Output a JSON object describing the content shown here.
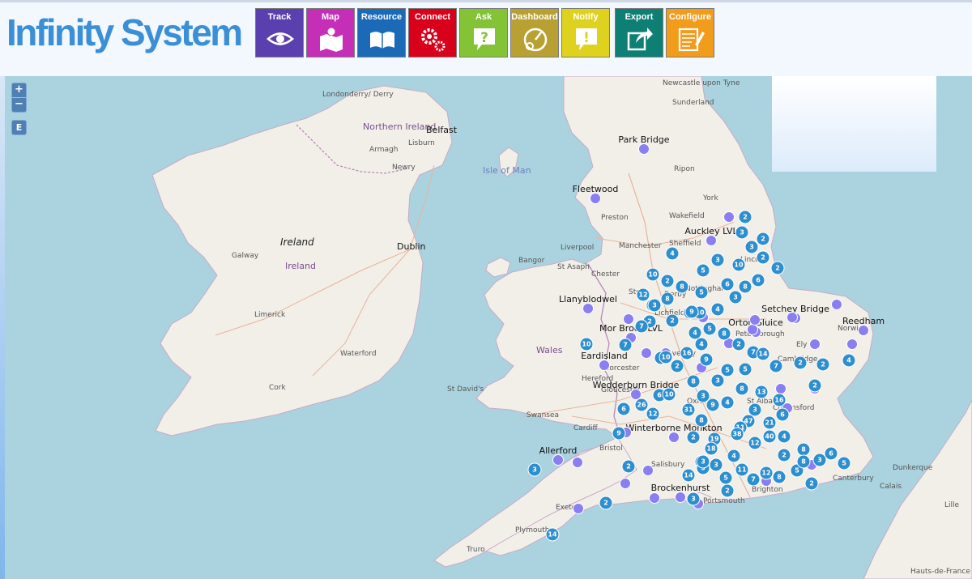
{
  "app": {
    "title": "Infinity System"
  },
  "toolbar": [
    {
      "label": "Track",
      "color": "#5a3fae",
      "icon": "eye-icon"
    },
    {
      "label": "Map",
      "color": "#c52fb7",
      "icon": "map-icon"
    },
    {
      "label": "Resource",
      "color": "#1b6ab8",
      "icon": "book-icon"
    },
    {
      "label": "Connect",
      "color": "#d9001b",
      "icon": "gears-icon"
    },
    {
      "label": "Ask",
      "color": "#84c336",
      "icon": "question-bubble-icon"
    },
    {
      "label": "Dashboard",
      "color": "#b8a132",
      "icon": "gauge-icon"
    },
    {
      "label": "Notify",
      "color": "#dfd21f",
      "icon": "exclamation-bubble-icon"
    },
    {
      "label": "Export",
      "color": "#0e7f74",
      "icon": "export-icon"
    },
    {
      "label": "Configure",
      "color": "#f29c1c",
      "icon": "form-edit-icon"
    }
  ],
  "map": {
    "zoom_in": "+",
    "zoom_out": "−",
    "extra_button": "E",
    "place_labels": [
      {
        "text": "Newcastle upon Tyne"
      },
      {
        "text": "Sunderland"
      },
      {
        "text": "Londonderry/ Derry"
      },
      {
        "text": "Northern Ireland"
      },
      {
        "text": "Belfast"
      },
      {
        "text": "Lisburn"
      },
      {
        "text": "Armagh"
      },
      {
        "text": "Newry"
      },
      {
        "text": "Isle of Man"
      },
      {
        "text": "Ireland"
      },
      {
        "text": "Ireland"
      },
      {
        "text": "Dublin"
      },
      {
        "text": "Galway"
      },
      {
        "text": "Limerick"
      },
      {
        "text": "Waterford"
      },
      {
        "text": "Cork"
      },
      {
        "text": "Ripon"
      },
      {
        "text": "York"
      },
      {
        "text": "Preston"
      },
      {
        "text": "Wakefield"
      },
      {
        "text": "Liverpool"
      },
      {
        "text": "Manchester"
      },
      {
        "text": "Sheffield"
      },
      {
        "text": "Bangor"
      },
      {
        "text": "St Asaph"
      },
      {
        "text": "Chester"
      },
      {
        "text": "Lincoln"
      },
      {
        "text": "Wales"
      },
      {
        "text": "Hereford"
      },
      {
        "text": "Worcester"
      },
      {
        "text": "Gloucester"
      },
      {
        "text": "Oxford"
      },
      {
        "text": "St Albans"
      },
      {
        "text": "Chelmsford"
      },
      {
        "text": "Cambridge"
      },
      {
        "text": "Ely"
      },
      {
        "text": "Norwich"
      },
      {
        "text": "Peterborough"
      },
      {
        "text": "St David's"
      },
      {
        "text": "Swansea"
      },
      {
        "text": "Cardiff"
      },
      {
        "text": "Bristol"
      },
      {
        "text": "Salisbury"
      },
      {
        "text": "Portsmouth"
      },
      {
        "text": "Brighton"
      },
      {
        "text": "Canterbury"
      },
      {
        "text": "Calais"
      },
      {
        "text": "Dunkerque"
      },
      {
        "text": "Lille"
      },
      {
        "text": "Hauts-de-France"
      },
      {
        "text": "Exeter"
      },
      {
        "text": "Plymouth"
      },
      {
        "text": "Truro"
      },
      {
        "text": "Lichfield"
      },
      {
        "text": "Stoke"
      },
      {
        "text": "Derby"
      },
      {
        "text": "Nottingham"
      },
      {
        "text": "Coventry"
      }
    ],
    "sites": [
      "Park Bridge",
      "Fleetwood",
      "Auckley LVL",
      "Llanyblodwel",
      "Setchey Bridge",
      "Orton Sluice",
      "Reedham",
      "Mor Brook LVL",
      "Eardisland",
      "Wedderburn Bridge",
      "Winterborne Monkton",
      "Allerford",
      "Brockenhurst"
    ],
    "cluster_counts": [
      "2",
      "3",
      "2",
      "3",
      "4",
      "2",
      "5",
      "10",
      "2",
      "3",
      "10",
      "2",
      "8",
      "6",
      "6",
      "8",
      "5",
      "3",
      "12",
      "8",
      "19",
      "3",
      "10",
      "5",
      "9",
      "4",
      "2",
      "2",
      "5",
      "7",
      "4",
      "8",
      "2",
      "10",
      "7",
      "16",
      "4",
      "7",
      "14",
      "2",
      "2",
      "5",
      "9",
      "10",
      "5",
      "7",
      "2",
      "2",
      "4",
      "8",
      "3",
      "2",
      "6",
      "8",
      "9",
      "4",
      "13",
      "3",
      "10",
      "16",
      "12",
      "6",
      "26",
      "31",
      "3",
      "8",
      "47",
      "21",
      "6",
      "11",
      "38",
      "9",
      "2",
      "12",
      "19",
      "18",
      "4",
      "40",
      "4",
      "11",
      "2",
      "8",
      "3",
      "6",
      "5",
      "2",
      "14",
      "3",
      "7",
      "12",
      "8",
      "5",
      "2",
      "3",
      "8",
      "2",
      "3",
      "5",
      "2",
      "3",
      "14",
      "3",
      "3"
    ]
  }
}
